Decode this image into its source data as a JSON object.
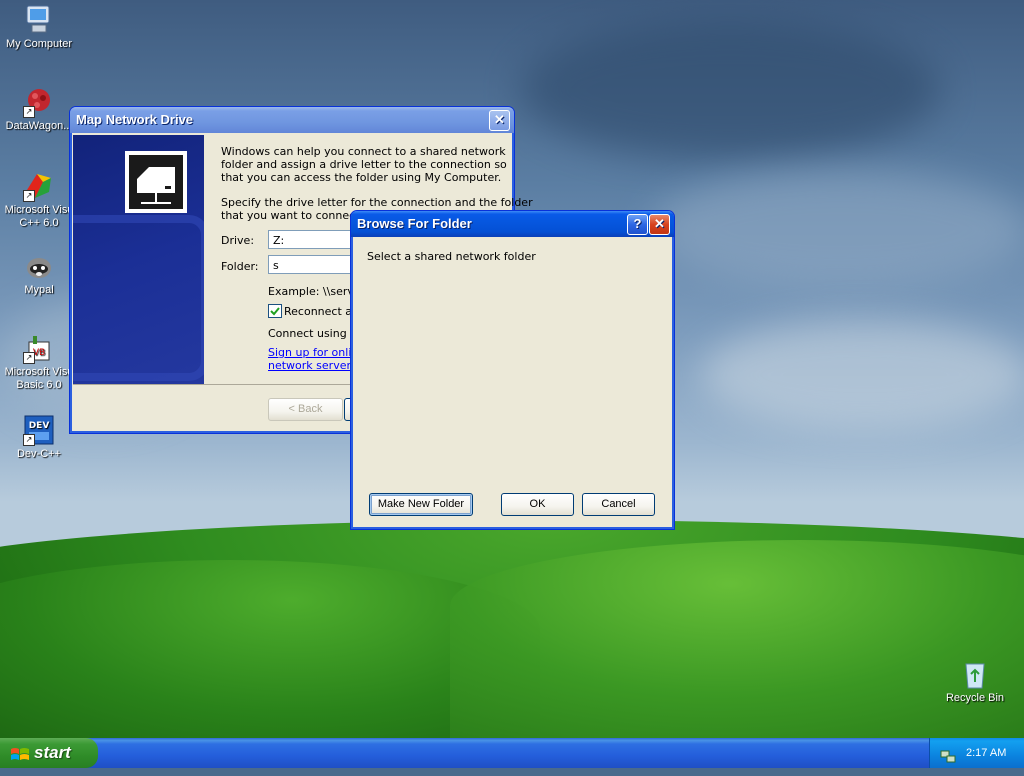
{
  "desktop": {
    "icons": [
      {
        "label": "My Computer"
      },
      {
        "label": "DataWagon..."
      },
      {
        "label": "Microsoft Visual C++ 6.0",
        "line1": "Microsoft Visu",
        "line2": "C++ 6.0"
      },
      {
        "label": "Mypal"
      },
      {
        "label": "Microsoft Visual Basic 6.0",
        "line1": "Microsoft Visu",
        "line2": "Basic 6.0"
      },
      {
        "label": "Dev-C++"
      },
      {
        "label": "Recycle Bin"
      }
    ]
  },
  "map_drive": {
    "title": "Map Network Drive",
    "intro": "Windows can help you connect to a shared network folder and assign a drive letter to the connection so that you can access the folder using My Computer.",
    "specify_line1": "Specify the drive letter for the connection and the folder",
    "specify_line2": "that you want to connect t",
    "drive_label": "Drive:",
    "drive_value": "Z:",
    "folder_label": "Folder:",
    "folder_value": "s",
    "example": "Example: \\\\serve",
    "reconnect": "Reconnect at",
    "connect_using": "Connect using a",
    "signup_line1": "Sign up for online",
    "signup_line2": "network server",
    "back_button": "< Back"
  },
  "browse": {
    "title": "Browse For Folder",
    "prompt": "Select a shared network folder",
    "make_new_folder": "Make New Folder",
    "ok": "OK",
    "cancel": "Cancel"
  },
  "taskbar": {
    "start_label": "start",
    "clock": "2:17 AM"
  },
  "colors": {
    "title_active": "#0657df",
    "button_border": "#003c74",
    "dialog_bg": "#ece9d8",
    "link": "#0000ff"
  }
}
